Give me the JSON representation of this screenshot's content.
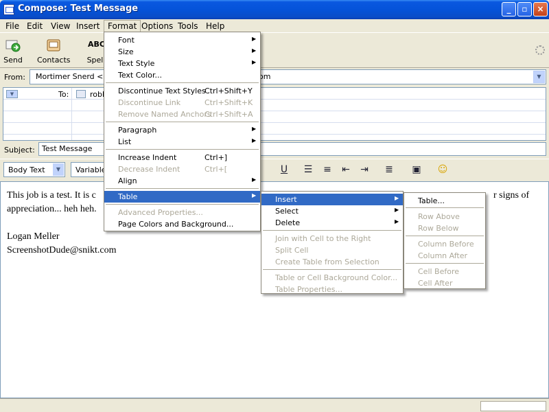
{
  "window": {
    "title": "Compose: Test Message"
  },
  "menubar": [
    "File",
    "Edit",
    "View",
    "Insert",
    "Format",
    "Options",
    "Tools",
    "Help"
  ],
  "toolbar": {
    "send": "Send",
    "contacts": "Contacts",
    "spell": "Spell",
    "spell_icon_text": "ABC"
  },
  "header": {
    "from_label": "From:",
    "from_value_left": "Mortimer Snerd <us",
    "from_value_right": "om",
    "to_label": "To:",
    "to_value": "robb",
    "subject_label": "Subject:",
    "subject_value": "Test Message"
  },
  "format_toolbar": {
    "paragraph_style": "Body Text",
    "font": "Variable"
  },
  "body": {
    "line1_left": "This job is a test.  It is c",
    "line1_right": "r signs of",
    "line2": "appreciation... heh heh.",
    "signature_name": "Logan Meller",
    "signature_email": "ScreenshotDude@snikt.com"
  },
  "format_menu": {
    "items": [
      {
        "label": "Font",
        "shortcut": "",
        "submenu": true,
        "disabled": false
      },
      {
        "label": "Size",
        "shortcut": "",
        "submenu": true,
        "disabled": false
      },
      {
        "label": "Text Style",
        "shortcut": "",
        "submenu": true,
        "disabled": false
      },
      {
        "label": "Text Color...",
        "shortcut": "",
        "submenu": false,
        "disabled": false
      },
      {
        "label": "Discontinue Text Styles",
        "shortcut": "Ctrl+Shift+Y",
        "submenu": false,
        "disabled": false
      },
      {
        "label": "Discontinue Link",
        "shortcut": "Ctrl+Shift+K",
        "submenu": false,
        "disabled": true
      },
      {
        "label": "Remove Named Anchors",
        "shortcut": "Ctrl+Shift+A",
        "submenu": false,
        "disabled": true
      },
      {
        "label": "Paragraph",
        "shortcut": "",
        "submenu": true,
        "disabled": false
      },
      {
        "label": "List",
        "shortcut": "",
        "submenu": true,
        "disabled": false
      },
      {
        "label": "Increase Indent",
        "shortcut": "Ctrl+]",
        "submenu": false,
        "disabled": false
      },
      {
        "label": "Decrease Indent",
        "shortcut": "Ctrl+[",
        "submenu": false,
        "disabled": true
      },
      {
        "label": "Align",
        "shortcut": "",
        "submenu": true,
        "disabled": false
      },
      {
        "label": "Table",
        "shortcut": "",
        "submenu": true,
        "disabled": false,
        "highlighted": true
      },
      {
        "label": "Advanced Properties...",
        "shortcut": "",
        "submenu": false,
        "disabled": true
      },
      {
        "label": "Page Colors and Background...",
        "shortcut": "",
        "submenu": false,
        "disabled": false
      }
    ]
  },
  "table_menu": {
    "items": [
      {
        "label": "Insert",
        "submenu": true,
        "disabled": false,
        "highlighted": true
      },
      {
        "label": "Select",
        "submenu": true,
        "disabled": false
      },
      {
        "label": "Delete",
        "submenu": true,
        "disabled": false
      },
      {
        "label": "Join with Cell to the Right",
        "submenu": false,
        "disabled": true
      },
      {
        "label": "Split Cell",
        "submenu": false,
        "disabled": true
      },
      {
        "label": "Create Table from Selection",
        "submenu": false,
        "disabled": true
      },
      {
        "label": "Table or Cell Background Color...",
        "submenu": false,
        "disabled": true
      },
      {
        "label": "Table Properties...",
        "submenu": false,
        "disabled": true
      }
    ]
  },
  "insert_menu": {
    "items": [
      {
        "label": "Table...",
        "disabled": false
      },
      {
        "label": "Row Above",
        "disabled": true
      },
      {
        "label": "Row Below",
        "disabled": true
      },
      {
        "label": "Column Before",
        "disabled": true
      },
      {
        "label": "Column After",
        "disabled": true
      },
      {
        "label": "Cell Before",
        "disabled": true
      },
      {
        "label": "Cell After",
        "disabled": true
      }
    ]
  },
  "colors": {
    "menu_highlight": "#316ac5",
    "disabled_text": "#aca899",
    "titlebar": "#0553d9"
  }
}
